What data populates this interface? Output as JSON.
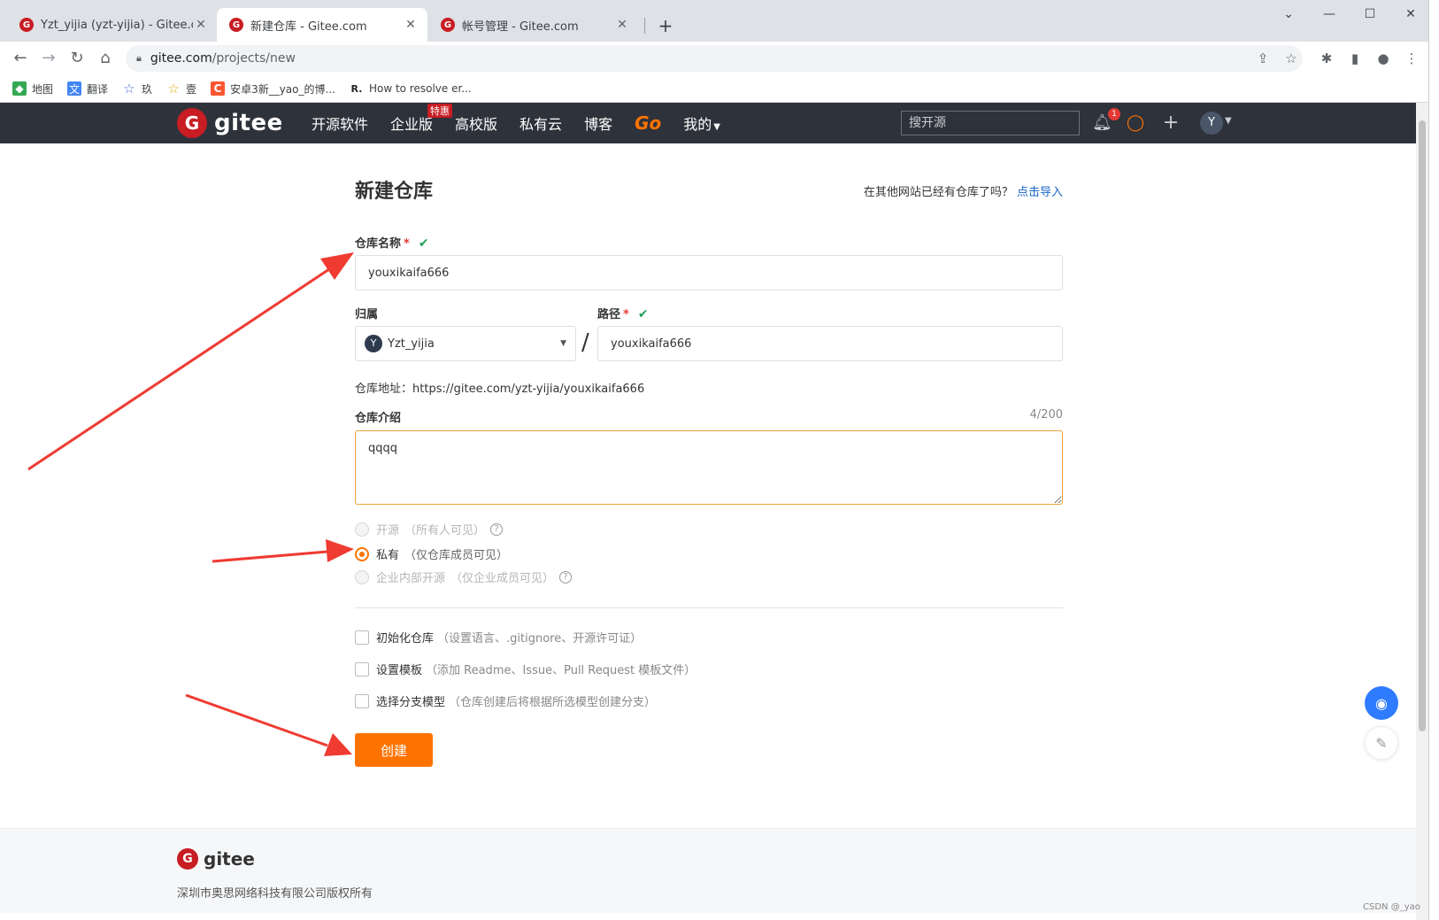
{
  "browser": {
    "tabs": [
      {
        "title": "Yzt_yijia (yzt-yijia) - Gitee.com",
        "favicon": "gitee-favicon"
      },
      {
        "title": "新建仓库 - Gitee.com",
        "favicon": "gitee-favicon",
        "active": true
      },
      {
        "title": "帐号管理 - Gitee.com",
        "favicon": "gitee-favicon"
      }
    ],
    "url_host": "gitee.com",
    "url_path": "/projects/new",
    "bookmarks": [
      {
        "label": "地图",
        "icon": "maps-icon"
      },
      {
        "label": "翻译",
        "icon": "translate-icon"
      },
      {
        "label": "玖",
        "icon": "star-icon"
      },
      {
        "label": "壹",
        "icon": "star-icon"
      },
      {
        "label": "安卓3新__yao_的博...",
        "icon": "csdn-icon"
      },
      {
        "label": "How to resolve er...",
        "icon": "r-icon"
      }
    ]
  },
  "header": {
    "logo_text": "gitee",
    "nav": [
      "开源软件",
      "企业版",
      "高校版",
      "私有云",
      "博客",
      "Go",
      "我的"
    ],
    "enterprise_badge": "特惠",
    "search_placeholder": "搜开源",
    "notification_count": "1",
    "avatar_letter": "Y"
  },
  "form": {
    "title": "新建仓库",
    "import_hint": "在其他网站已经有仓库了吗？",
    "import_link": "点击导入",
    "repo_name_label": "仓库名称",
    "repo_name_value": "youxikaifa666",
    "owner_label": "归属",
    "owner_value": "Yzt_yijia",
    "owner_avatar": "Y",
    "path_label": "路径",
    "path_value": "youxikaifa666",
    "address_label": "仓库地址：",
    "address_value": "https://gitee.com/yzt-yijia/youxikaifa666",
    "desc_label": "仓库介绍",
    "desc_counter": "4/200",
    "desc_value": "qqqq",
    "visibility": [
      {
        "label": "开源",
        "hint": "（所有人可见）",
        "help": true,
        "disabled": true
      },
      {
        "label": "私有",
        "hint": "（仅仓库成员可见）",
        "checked": true
      },
      {
        "label": "企业内部开源",
        "hint": "（仅企业成员可见）",
        "help": true,
        "disabled": true
      }
    ],
    "options": [
      {
        "label": "初始化仓库",
        "hint": "（设置语言、.gitignore、开源许可证）"
      },
      {
        "label": "设置模板",
        "hint": "（添加 Readme、Issue、Pull Request 模板文件）"
      },
      {
        "label": "选择分支模型",
        "hint": "（仓库创建后将根据所选模型创建分支）"
      }
    ],
    "submit_label": "创建"
  },
  "footer": {
    "logo_text": "gitee",
    "copyright": "深圳市奥思网络科技有限公司版权所有"
  },
  "watermark": "CSDN @_yao",
  "colors": {
    "brand_red": "#c71d23",
    "accent_orange": "#fe7300",
    "header_bg": "#2e323a",
    "link_blue": "#1a69c8",
    "success_green": "#21a35c",
    "arrow_red": "#ef3b32"
  }
}
